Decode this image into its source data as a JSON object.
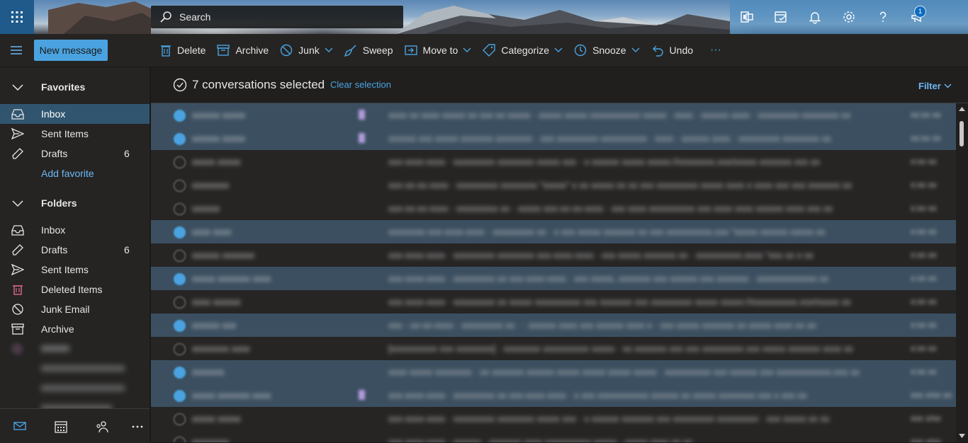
{
  "header": {
    "search_placeholder": "Search",
    "notification_count": "1"
  },
  "command_bar": {
    "new_message": "New message",
    "delete": "Delete",
    "archive": "Archive",
    "junk": "Junk",
    "sweep": "Sweep",
    "move_to": "Move to",
    "categorize": "Categorize",
    "snooze": "Snooze",
    "undo": "Undo",
    "more": "···"
  },
  "nav": {
    "favorites_title": "Favorites",
    "favorites": [
      {
        "label": "Inbox",
        "icon": "inbox-icon",
        "count": ""
      },
      {
        "label": "Sent Items",
        "icon": "send-icon",
        "count": ""
      },
      {
        "label": "Drafts",
        "icon": "pencil-icon",
        "count": "6"
      }
    ],
    "add_favorite": "Add favorite",
    "folders_title": "Folders",
    "folders": [
      {
        "label": "Inbox",
        "icon": "inbox-icon",
        "count": ""
      },
      {
        "label": "Drafts",
        "icon": "pencil-icon",
        "count": "6"
      },
      {
        "label": "Sent Items",
        "icon": "send-icon",
        "count": ""
      },
      {
        "label": "Deleted Items",
        "icon": "trash-icon",
        "count": ""
      },
      {
        "label": "Junk Email",
        "icon": "block-icon",
        "count": ""
      },
      {
        "label": "Archive",
        "icon": "archive-icon",
        "count": ""
      }
    ]
  },
  "list": {
    "selected_text": "7 conversations selected",
    "clear_selection": "Clear selection",
    "filter": "Filter"
  },
  "colors": {
    "accent": "#4aa3e0",
    "selected_row": "#3b4f60",
    "nav_selected": "#31556f"
  }
}
